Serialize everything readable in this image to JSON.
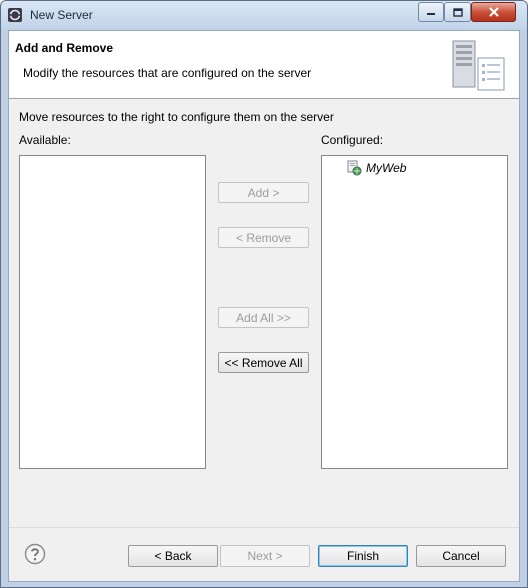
{
  "window": {
    "title": "New Server",
    "controls": {
      "minimize": "minimize-icon",
      "maximize": "maximize-icon",
      "close": "close-icon"
    }
  },
  "header": {
    "title": "Add and Remove",
    "description": "Modify the resources that are configured on the server",
    "image": "server-wizard-icon"
  },
  "content": {
    "instruction": "Move resources to the right to configure them on the server",
    "available_label": "Available:",
    "configured_label": "Configured:",
    "available_items": [],
    "configured_items": [
      {
        "label": "MyWeb",
        "icon": "web-project-icon"
      }
    ]
  },
  "buttons": {
    "add": "Add >",
    "remove": "< Remove",
    "add_all": "Add All >>",
    "remove_all": "<< Remove All",
    "back": "< Back",
    "next": "Next >",
    "finish": "Finish",
    "cancel": "Cancel"
  },
  "colors": {
    "accent": "#3c7fb1",
    "disabled_text": "#9c9c9c",
    "dialog_bg": "#f0f0f0",
    "close_button": "#c84b33"
  }
}
